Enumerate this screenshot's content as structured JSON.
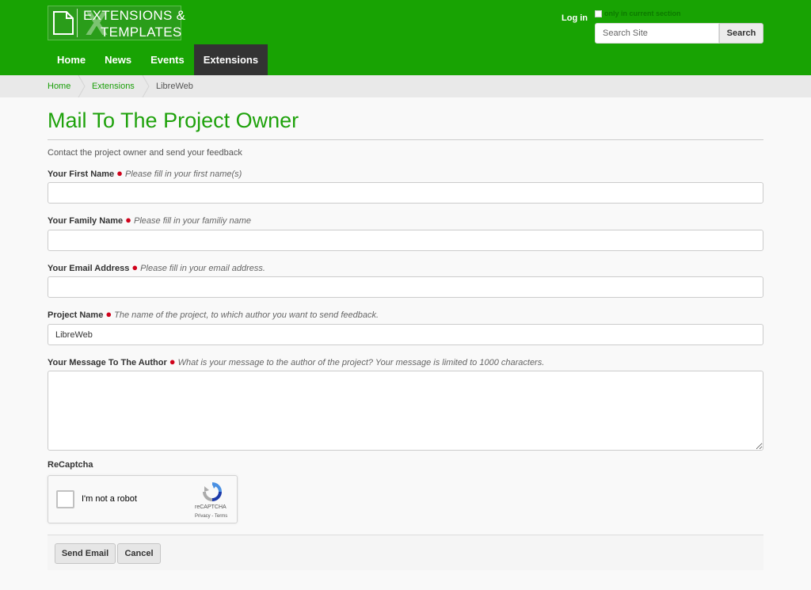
{
  "header": {
    "logo_line1": "EXTENSIONS &",
    "logo_line2": "TEMPLATES",
    "login": "Log in",
    "section_label": "only in current section",
    "search_placeholder": "Search Site",
    "search_button": "Search",
    "nav": [
      {
        "label": "Home",
        "active": false
      },
      {
        "label": "News",
        "active": false
      },
      {
        "label": "Events",
        "active": false
      },
      {
        "label": "Extensions",
        "active": true
      }
    ]
  },
  "breadcrumb": [
    "Home",
    "Extensions",
    "LibreWeb"
  ],
  "main": {
    "title": "Mail To The Project Owner",
    "description": "Contact the project owner and send your feedback",
    "fields": [
      {
        "label": "Your First Name",
        "help": "Please fill in your first name(s)",
        "value": ""
      },
      {
        "label": "Your Family Name",
        "help": "Please fill in your familiy name",
        "value": ""
      },
      {
        "label": "Your Email Address",
        "help": "Please fill in your email address.",
        "value": ""
      },
      {
        "label": "Project Name",
        "help": "The name of the project, to which author you want to send feedback.",
        "value": "LibreWeb"
      },
      {
        "label": "Your Message To The Author",
        "help": "What is your message to the author of the project? Your message is limited to 1000 characters.",
        "value": ""
      }
    ],
    "required_marker": "●",
    "recaptcha": {
      "label": "ReCaptcha",
      "checkbox_text": "I'm not a robot",
      "brand": "reCAPTCHA",
      "links": "Privacy - Terms"
    },
    "buttons": {
      "send": "Send Email",
      "cancel": "Cancel"
    }
  },
  "colors": {
    "brand_green": "#18a303",
    "title_green": "#1fa20c",
    "nav_active": "#333333",
    "required": "#d0021b"
  }
}
